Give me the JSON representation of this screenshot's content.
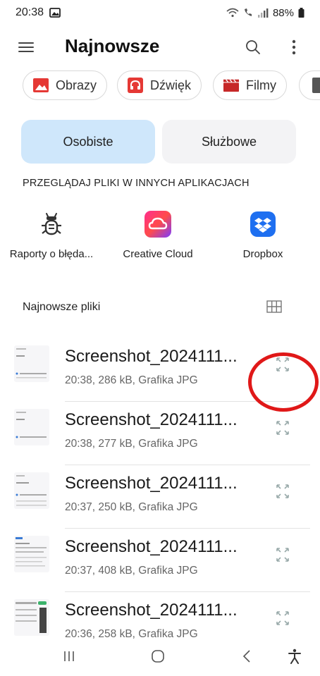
{
  "status_bar": {
    "time": "20:38",
    "battery": "88%"
  },
  "app_bar": {
    "title": "Najnowsze"
  },
  "chips": [
    {
      "label": "Obrazy",
      "icon": "image-icon",
      "color": "#e53935"
    },
    {
      "label": "Dźwięk",
      "icon": "headphones-icon",
      "color": "#e53935"
    },
    {
      "label": "Filmy",
      "icon": "clapperboard-icon",
      "color": "#c62828"
    }
  ],
  "tabs": {
    "personal": "Osobiste",
    "work": "Służbowe"
  },
  "browse_section": {
    "title": "PRZEGLĄDAJ PLIKI W INNYCH APLIKACJACH"
  },
  "apps": [
    {
      "label": "Raporty o błęda...",
      "icon": "bug-icon"
    },
    {
      "label": "Creative Cloud",
      "icon": "creative-cloud-icon"
    },
    {
      "label": "Dropbox",
      "icon": "dropbox-icon"
    }
  ],
  "recent": {
    "title": "Najnowsze pliki"
  },
  "files": [
    {
      "name": "Screenshot_2024111...",
      "meta": "20:38, 286 kB, Grafika JPG"
    },
    {
      "name": "Screenshot_2024111...",
      "meta": "20:38, 277 kB, Grafika JPG"
    },
    {
      "name": "Screenshot_2024111...",
      "meta": "20:37, 250 kB, Grafika JPG"
    },
    {
      "name": "Screenshot_2024111...",
      "meta": "20:37, 408 kB, Grafika JPG"
    },
    {
      "name": "Screenshot_2024111...",
      "meta": "20:36, 258 kB, Grafika JPG"
    }
  ],
  "colors": {
    "accent_tab": "#cfe7fb",
    "highlight": "#e01818",
    "dropbox": "#1e6ff0"
  }
}
